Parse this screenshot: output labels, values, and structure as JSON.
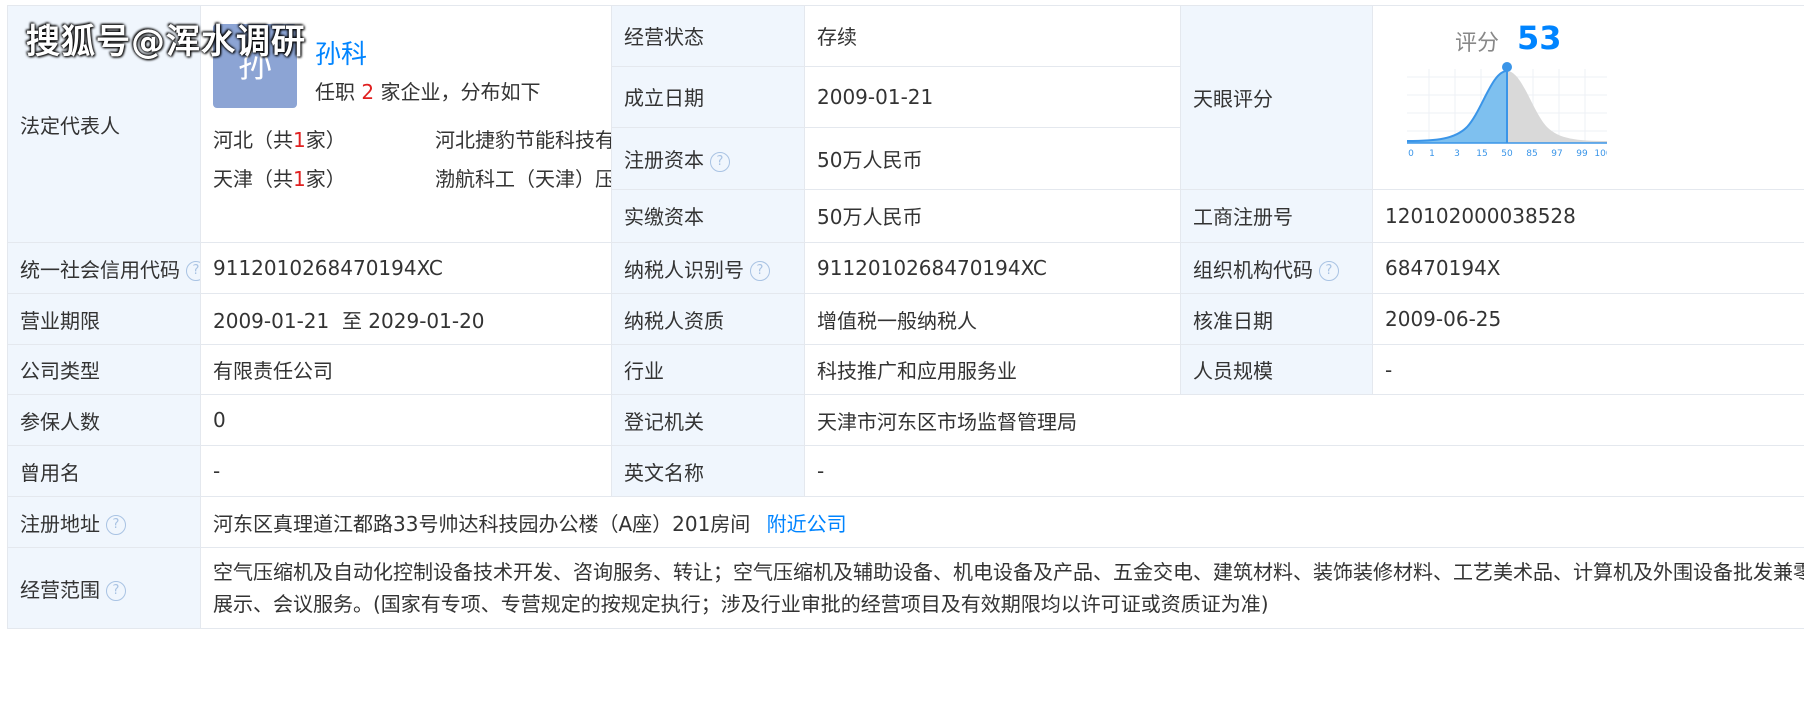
{
  "watermark": "搜狐号@浑水调研",
  "legal_rep": {
    "label": "法定代表人",
    "avatar_char": "孙",
    "name": "孙科",
    "positions_prefix": "任职",
    "positions_count": "2",
    "positions_suffix": "家企业，分布如下",
    "regions": [
      {
        "prov": "河北（共",
        "count": "1",
        "unit": "家）",
        "company": "河北捷豹节能科技有..."
      },
      {
        "prov": "天津（共",
        "count": "1",
        "unit": "家）",
        "company": "渤航科工（天津）压..."
      }
    ]
  },
  "row_status": {
    "label": "经营状态",
    "value": "存续"
  },
  "row_founded": {
    "label": "成立日期",
    "value": "2009-01-21"
  },
  "row_capital": {
    "label": "注册资本",
    "value": "50万人民币"
  },
  "row_paid": {
    "label": "实缴资本",
    "value": "50万人民币"
  },
  "tianyan": {
    "label": "天眼评分",
    "score_label": "评分",
    "score": "53",
    "ticks": [
      "0",
      "1",
      "3",
      "15",
      "50",
      "85",
      "97",
      "99",
      "100"
    ]
  },
  "reg_no": {
    "label": "工商注册号",
    "value": "120102000038528"
  },
  "credit_code": {
    "label": "统一社会信用代码",
    "value": "9112010268470194XC"
  },
  "taxpayer_id": {
    "label": "纳税人识别号",
    "value": "9112010268470194XC"
  },
  "org_code": {
    "label": "组织机构代码",
    "value": "68470194X"
  },
  "term": {
    "label": "营业期限",
    "value": "2009-01-21  至 2029-01-20"
  },
  "tax_qual": {
    "label": "纳税人资质",
    "value": "增值税一般纳税人"
  },
  "approve_date": {
    "label": "核准日期",
    "value": "2009-06-25"
  },
  "company_type": {
    "label": "公司类型",
    "value": "有限责任公司"
  },
  "industry": {
    "label": "行业",
    "value": "科技推广和应用服务业"
  },
  "staff": {
    "label": "人员规模",
    "value": "-"
  },
  "insured": {
    "label": "参保人数",
    "value": "0"
  },
  "authority": {
    "label": "登记机关",
    "value": "天津市河东区市场监督管理局"
  },
  "former_name": {
    "label": "曾用名",
    "value": "-"
  },
  "en_name": {
    "label": "英文名称",
    "value": "-"
  },
  "address": {
    "label": "注册地址",
    "value": "河东区真理道江都路33号帅达科技园办公楼（A座）201房间",
    "link": "附近公司"
  },
  "scope": {
    "label": "经营范围",
    "value": "空气压缩机及自动化控制设备技术开发、咨询服务、转让；空气压缩机及辅助设备、机电设备及产品、五金交电、建筑材料、装饰装修材料、工艺美术品、计算机及外围设备批发兼零售；展览展示、会议服务。(国家有专项、专营规定的按规定执行；涉及行业审批的经营项目及有效期限均以许可证或资质证为准)"
  },
  "help_glyph": "?",
  "colors": {
    "label_bg": "#f0f6fd",
    "border": "#e4e8ee",
    "link": "#0084ff",
    "accent_red": "#e02020"
  }
}
